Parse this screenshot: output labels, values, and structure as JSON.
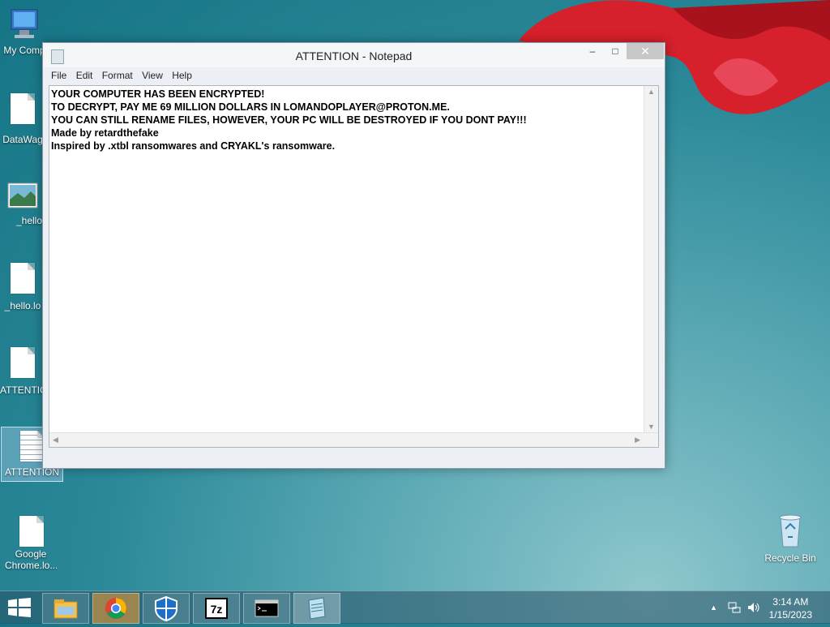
{
  "desktop": {
    "icons": [
      {
        "label": "My Comp"
      },
      {
        "label": "DataWag"
      },
      {
        "label": "_hello"
      },
      {
        "label": "_hello.lo"
      },
      {
        "label": "ATTENTIO"
      },
      {
        "label": "ATTENTION"
      },
      {
        "label": "Google Chrome.lo..."
      },
      {
        "label": "Recycle Bin"
      }
    ]
  },
  "window": {
    "title": "ATTENTION - Notepad",
    "buttons": {
      "minimize": "–",
      "maximize": "□",
      "close": "✕"
    },
    "menu": [
      "File",
      "Edit",
      "Format",
      "View",
      "Help"
    ],
    "content": "YOUR COMPUTER HAS BEEN ENCRYPTED!\nTO DECRYPT, PAY ME 69 MILLION DOLLARS IN LOMANDOPLAYER@PROTON.ME.\nYOU CAN STILL RENAME FILES, HOWEVER, YOUR PC WILL BE DESTROYED IF YOU DONT PAY!!!\nMade by retardthefake\nInspired by .xtbl ransomwares and CRYAKL's ransomware."
  },
  "taskbar": {
    "apps": [
      "file-explorer",
      "google-chrome",
      "windows-defender",
      "7-zip",
      "command-prompt",
      "notepad"
    ],
    "clock": {
      "time": "3:14 AM",
      "date": "1/15/2023"
    }
  }
}
